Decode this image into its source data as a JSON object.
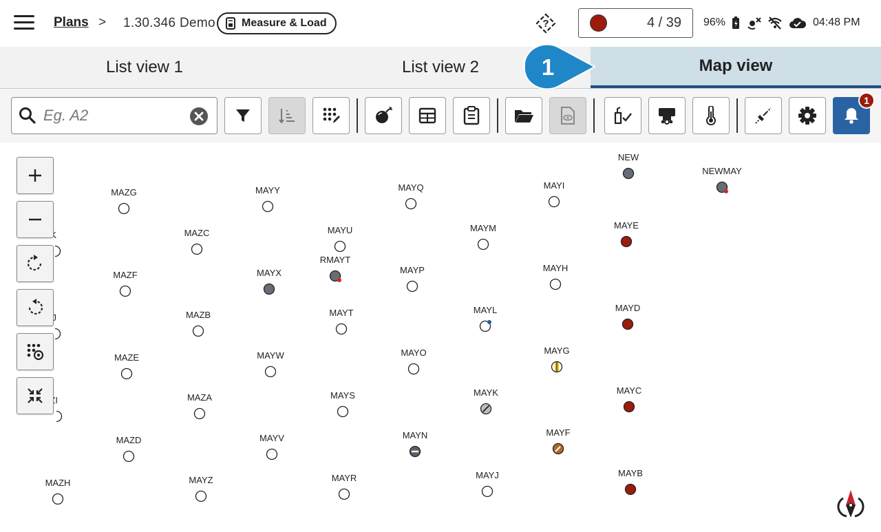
{
  "header": {
    "menu_icon": "hamburger-icon",
    "breadcrumb_root": "Plans",
    "breadcrumb_separator": ">",
    "project": "1.30.346 Demo",
    "mode_label": "Measure & Load",
    "help_icon": "help-icon",
    "counter_text": "4 / 39",
    "counter_color": "#9b1c0c",
    "battery": "96%",
    "time": "04:48 PM"
  },
  "tabs": [
    {
      "label": "List view 1",
      "active": false
    },
    {
      "label": "List view 2",
      "active": false
    },
    {
      "label": "Map view",
      "active": true
    }
  ],
  "callout_number": "1",
  "toolbar": {
    "search_placeholder": "Eg. A2",
    "search_value": "",
    "notification_count": "1",
    "buttons": [
      "filter-icon",
      "sort-icon",
      "grid-edit-icon",
      "blast-icon",
      "table-icon",
      "clipboard-icon",
      "folder-icon",
      "file-view-icon",
      "check-load-icon",
      "truck-icon",
      "thermometer-icon",
      "wire-icon",
      "gear-icon",
      "bell-icon"
    ]
  },
  "map": {
    "controls": [
      "zoom-in-icon",
      "zoom-out-icon",
      "rotate-cw-icon",
      "rotate-ccw-icon",
      "select-icon",
      "fit-icon"
    ],
    "holes": [
      {
        "label": "MAZG",
        "type": "empty"
      },
      {
        "label": "MAYY",
        "type": "empty"
      },
      {
        "label": "MAYQ",
        "type": "empty"
      },
      {
        "label": "MAYI",
        "type": "empty"
      },
      {
        "label": "NEW",
        "type": "gray"
      },
      {
        "label": "NEWMAY",
        "type": "gray-flag"
      },
      {
        "label": "ZK",
        "type": "partial"
      },
      {
        "label": "MAZC",
        "type": "empty"
      },
      {
        "label": "MAYU",
        "type": "empty"
      },
      {
        "label": "MAYM",
        "type": "empty"
      },
      {
        "label": "MAYE",
        "type": "red"
      },
      {
        "label": "RMAYT",
        "type": "gray-flag"
      },
      {
        "label": "MAZF",
        "type": "empty"
      },
      {
        "label": "MAYX",
        "type": "gray"
      },
      {
        "label": "MAYP",
        "type": "empty"
      },
      {
        "label": "MAYH",
        "type": "empty"
      },
      {
        "label": "MAYD",
        "type": "red"
      },
      {
        "label": "ZJ",
        "type": "partial"
      },
      {
        "label": "MAZB",
        "type": "empty"
      },
      {
        "label": "MAYT",
        "type": "empty"
      },
      {
        "label": "MAYL",
        "type": "blue-dot"
      },
      {
        "label": "MAZE",
        "type": "empty"
      },
      {
        "label": "MAYW",
        "type": "empty"
      },
      {
        "label": "MAYO",
        "type": "empty"
      },
      {
        "label": "MAYG",
        "type": "yellow-stripe"
      },
      {
        "label": "AZI",
        "type": "partial"
      },
      {
        "label": "MAZA",
        "type": "empty"
      },
      {
        "label": "MAYS",
        "type": "empty"
      },
      {
        "label": "MAYK",
        "type": "slash"
      },
      {
        "label": "MAYC",
        "type": "red"
      },
      {
        "label": "MAZD",
        "type": "empty"
      },
      {
        "label": "MAYV",
        "type": "empty"
      },
      {
        "label": "MAYN",
        "type": "minus"
      },
      {
        "label": "MAYF",
        "type": "brown-pen"
      },
      {
        "label": "MAZH",
        "type": "empty"
      },
      {
        "label": "MAYZ",
        "type": "empty"
      },
      {
        "label": "MAYR",
        "type": "empty"
      },
      {
        "label": "MAYJ",
        "type": "empty"
      },
      {
        "label": "MAYB",
        "type": "red"
      }
    ],
    "compass_icon": "compass-icon"
  },
  "colors": {
    "accent": "#2a63a4",
    "active_tab": "#cfdfe8",
    "hole_red": "#9b1c0c",
    "hole_gray": "#676d75",
    "callout": "#1f87c8"
  }
}
